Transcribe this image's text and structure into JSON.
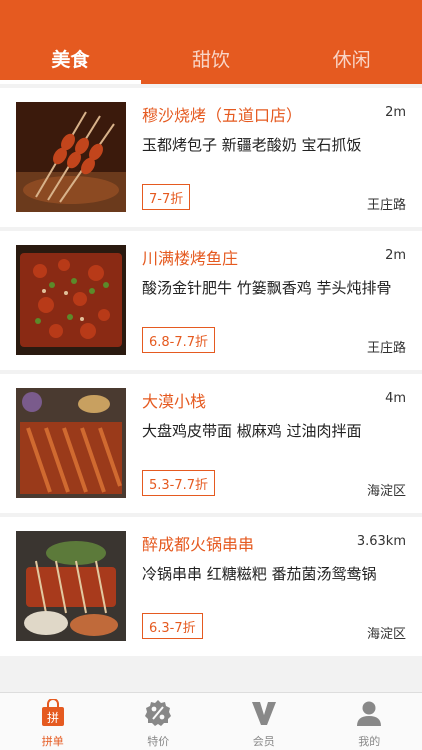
{
  "tabs": [
    {
      "label": "美食",
      "active": true
    },
    {
      "label": "甜饮",
      "active": false
    },
    {
      "label": "休闲",
      "active": false
    }
  ],
  "restaurants": [
    {
      "name": "穆沙烧烤（五道口店）",
      "distance": "2m",
      "dishes": "玉都烤包子 新疆老酸奶 宝石抓饭",
      "discount": "7-7折",
      "area": "王庄路",
      "image": "skewers-photo"
    },
    {
      "name": "川满楼烤鱼庄",
      "distance": "2m",
      "dishes": "酸汤金针肥牛 竹篓飘香鸡 芋头炖排骨",
      "discount": "6.8-7.7折",
      "area": "王庄路",
      "image": "grilled-fish-photo"
    },
    {
      "name": "大漠小栈",
      "distance": "4m",
      "dishes": "大盘鸡皮带面 椒麻鸡 过油肉拌面",
      "discount": "5.3-7.7折",
      "area": "海淀区",
      "image": "bbq-ribs-photo"
    },
    {
      "name": "醉成都火锅串串",
      "distance": "3.63km",
      "dishes": "冷锅串串 红糖糍粑 番茄菌汤鸳鸯锅",
      "discount": "6.3-7折",
      "area": "海淀区",
      "image": "hotpot-skewers-photo"
    }
  ],
  "nav": [
    {
      "label": "拼单",
      "icon": "shopping-bag-icon",
      "glyph": "拼",
      "active": true
    },
    {
      "label": "特价",
      "icon": "percent-badge-icon",
      "active": false
    },
    {
      "label": "会员",
      "icon": "vip-v-icon",
      "active": false
    },
    {
      "label": "我的",
      "icon": "user-icon",
      "active": false
    }
  ],
  "colors": {
    "accent": "#e55a20",
    "inactive": "#888888",
    "background": "#f2f2f2"
  }
}
